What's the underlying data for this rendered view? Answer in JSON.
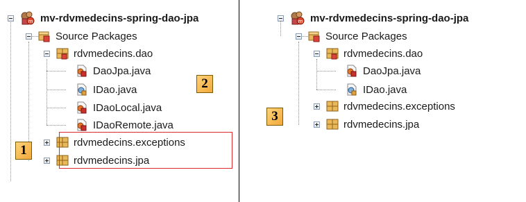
{
  "left_tree": {
    "project": "mv-rdvmedecins-spring-dao-jpa",
    "source_packages": "Source Packages",
    "package_dao": "rdvmedecins.dao",
    "files": [
      "DaoJpa.java",
      "IDao.java",
      "IDaoLocal.java",
      "IDaoRemote.java"
    ],
    "package_exceptions": "rdvmedecins.exceptions",
    "package_jpa": "rdvmedecins.jpa"
  },
  "right_tree": {
    "project": "mv-rdvmedecins-spring-dao-jpa",
    "source_packages": "Source Packages",
    "package_dao": "rdvmedecins.dao",
    "files": [
      "DaoJpa.java",
      "IDao.java"
    ],
    "package_exceptions": "rdvmedecins.exceptions",
    "package_jpa": "rdvmedecins.jpa"
  },
  "badges": {
    "one": "1",
    "two": "2",
    "three": "3"
  },
  "colors": {
    "highlight": "#e0282e",
    "badge": "#f2a93a"
  },
  "icons": {
    "project": "maven-project-icon",
    "source_packages": "source-packages-icon",
    "package": "package-icon",
    "class_file": "java-class-icon",
    "interface_file": "java-interface-icon"
  }
}
